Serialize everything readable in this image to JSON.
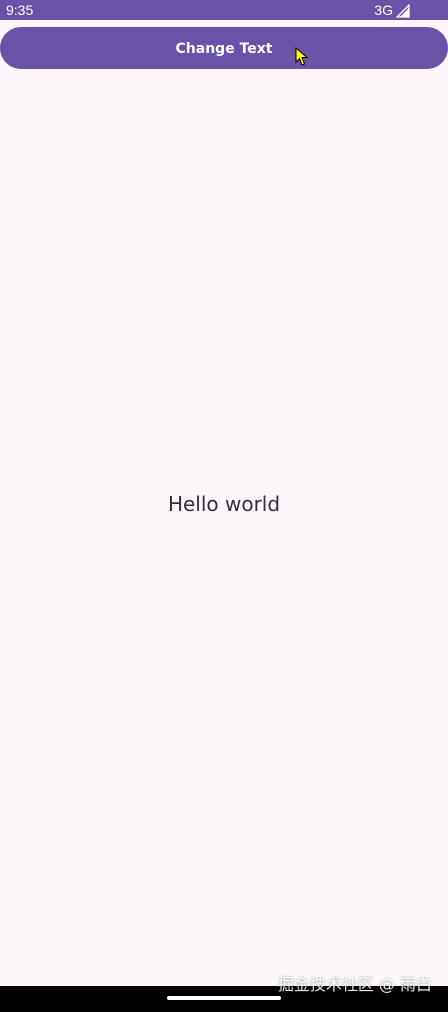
{
  "status_bar": {
    "time": "9:35",
    "network": "3G",
    "signal_icon": "signal-strength-icon",
    "background": "#6952a7"
  },
  "main": {
    "button_label": "Change Text",
    "text": "Hello world",
    "background": "#fdf7fc",
    "accent": "#6952a7"
  },
  "overlay": {
    "watermark": "掘金技术社区 @ 雨白",
    "cursor_icon": "pointer-cursor-icon"
  }
}
